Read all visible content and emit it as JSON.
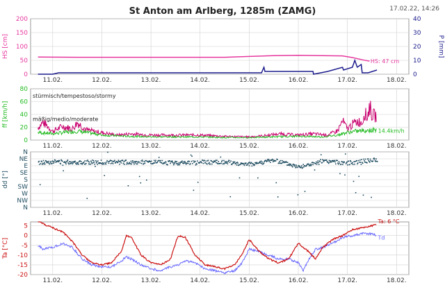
{
  "header": {
    "title": "St Anton am Arlberg, 1285m (ZAMG)",
    "timestamp": "17.02.22, 14:26"
  },
  "colors": {
    "hs": "#e6379e",
    "precip": "#1a1a8c",
    "ff": "#c8006e",
    "fx": "#22bb22",
    "dd": "#1c4a5e",
    "ta": "#cc1111",
    "td": "#6666ff",
    "frame": "#999999",
    "grid": "#d0d0d0",
    "text": "#333333"
  },
  "chart_data": [
    {
      "type": "line",
      "panel": "snow",
      "ylabel": "HS [cm]",
      "ylabel_right": "P [mm]",
      "ylim": [
        0,
        200
      ],
      "ylim_right": [
        0,
        40
      ],
      "yticks": [
        "0",
        "50",
        "100",
        "150",
        "200"
      ],
      "yticks_right": [
        "0",
        "10",
        "20",
        "30",
        "40"
      ],
      "x_categories": [
        "11.02.",
        "12.02.",
        "13.02.",
        "14.02.",
        "15.02.",
        "16.02.",
        "17.02.",
        "18.02."
      ],
      "annotation": "HS: 47 cm",
      "series": [
        {
          "name": "HS",
          "x": [
            10.7,
            11.5,
            12.5,
            13.5,
            14.5,
            15.0,
            15.5,
            16.0,
            16.5,
            16.9,
            17.1,
            17.3,
            17.45
          ],
          "y": [
            62,
            61,
            61,
            61,
            61,
            64,
            67,
            68,
            67,
            66,
            60,
            52,
            47
          ]
        },
        {
          "name": "P",
          "x": [
            10.7,
            11.0,
            11.12,
            12.0,
            13.0,
            14.0,
            15.0,
            15.25,
            15.3,
            15.32,
            15.5,
            15.8,
            16.0,
            16.3,
            16.31,
            16.6,
            16.9,
            16.92,
            17.1,
            17.15,
            17.2,
            17.28,
            17.3,
            17.42,
            17.6
          ],
          "y": [
            0,
            0,
            1,
            1,
            1,
            1,
            1,
            1,
            5,
            2,
            2,
            2,
            2,
            2,
            0,
            2,
            5,
            3,
            5,
            10,
            5,
            7,
            1,
            1,
            3
          ]
        }
      ]
    },
    {
      "type": "line",
      "panel": "wind",
      "ylabel": "ff [km/h]",
      "ylim": [
        0,
        80
      ],
      "yticks": [
        "0",
        "20",
        "40",
        "60",
        "80"
      ],
      "x_categories": [
        "11.02.",
        "12.02.",
        "13.02.",
        "14.02.",
        "15.02.",
        "16.02.",
        "17.02.",
        "18.02."
      ],
      "bands": [
        "stürmisch/tempestoso/stormy",
        "mäßig/medio/moderate"
      ],
      "annotation": "ff: 14.4km/h",
      "series": [
        {
          "name": "ff_max",
          "x": [
            10.7,
            10.8,
            10.9,
            11.0,
            11.2,
            11.4,
            11.5,
            11.7,
            12.0,
            12.3,
            12.6,
            13.0,
            13.5,
            14.0,
            14.5,
            15.0,
            15.3,
            15.6,
            16.0,
            16.3,
            16.6,
            16.8,
            16.9,
            17.0,
            17.1,
            17.2,
            17.3,
            17.35,
            17.4,
            17.45,
            17.5,
            17.6
          ],
          "y": [
            20,
            28,
            22,
            14,
            22,
            18,
            28,
            16,
            12,
            8,
            10,
            8,
            8,
            8,
            6,
            5,
            7,
            10,
            8,
            10,
            8,
            15,
            30,
            18,
            25,
            30,
            28,
            45,
            35,
            55,
            40,
            38
          ]
        },
        {
          "name": "ff_mean",
          "x": [
            10.7,
            11.0,
            11.5,
            12.0,
            12.5,
            13.0,
            13.5,
            14.0,
            14.5,
            15.0,
            15.5,
            16.0,
            16.5,
            16.8,
            17.0,
            17.2,
            17.4,
            17.6
          ],
          "y": [
            12,
            10,
            14,
            8,
            6,
            5,
            5,
            5,
            4,
            4,
            5,
            6,
            5,
            8,
            12,
            14,
            15,
            16
          ]
        }
      ]
    },
    {
      "type": "scatter",
      "panel": "direction",
      "ylabel": "dd [°]",
      "ylim": [
        0,
        8
      ],
      "yticks": [
        "N",
        "NW",
        "W",
        "SW",
        "S",
        "SE",
        "E",
        "NE",
        "N"
      ],
      "x_categories": [
        "11.02.",
        "12.02.",
        "13.02.",
        "14.02.",
        "15.02.",
        "16.02.",
        "17.02.",
        "18.02."
      ],
      "series": [
        {
          "name": "dd",
          "x": [
            10.7,
            11.0,
            11.5,
            12.0,
            12.5,
            13.0,
            13.5,
            14.0,
            14.5,
            15.0,
            15.5,
            16.0,
            16.5,
            17.0,
            17.5
          ],
          "y": [
            6.4,
            6.6,
            6.5,
            6.5,
            6.5,
            6.5,
            6.4,
            6.5,
            6.5,
            6.2,
            6.8,
            5.8,
            6.6,
            6.4,
            6.8
          ]
        }
      ]
    },
    {
      "type": "line",
      "panel": "temperature",
      "ylabel": "Ta [°C]",
      "ylim": [
        -20,
        7
      ],
      "yticks": [
        "-20",
        "-15",
        "-10",
        "-5",
        "0",
        "5"
      ],
      "x_categories": [
        "11.02.",
        "12.02.",
        "13.02.",
        "14.02.",
        "15.02.",
        "16.02.",
        "17.02.",
        "18.02."
      ],
      "annotations": [
        "Ta: 6 °C",
        "Td"
      ],
      "series": [
        {
          "name": "Ta",
          "x": [
            10.7,
            10.8,
            11.0,
            11.2,
            11.4,
            11.6,
            11.8,
            12.0,
            12.2,
            12.4,
            12.5,
            12.6,
            12.8,
            13.0,
            13.2,
            13.4,
            13.55,
            13.7,
            13.9,
            14.1,
            14.3,
            14.5,
            14.7,
            14.85,
            15.0,
            15.2,
            15.4,
            15.6,
            15.8,
            16.0,
            16.1,
            16.2,
            16.35,
            16.5,
            16.7,
            16.9,
            17.1,
            17.3,
            17.5,
            17.6
          ],
          "y": [
            8,
            6,
            4,
            2,
            -3,
            -10,
            -14,
            -15,
            -14,
            -8,
            0,
            -1,
            -10,
            -14,
            -15,
            -12,
            0,
            -1,
            -10,
            -15,
            -16,
            -17,
            -15,
            -10,
            -2,
            -8,
            -12,
            -14,
            -12,
            -4,
            -6,
            -8,
            -12,
            -6,
            -2,
            0,
            3,
            4,
            5,
            6
          ]
        },
        {
          "name": "Td",
          "x": [
            10.7,
            10.8,
            11.0,
            11.2,
            11.4,
            11.6,
            11.8,
            12.0,
            12.2,
            12.4,
            12.5,
            12.6,
            12.8,
            13.0,
            13.2,
            13.4,
            13.55,
            13.7,
            13.9,
            14.1,
            14.3,
            14.5,
            14.7,
            14.85,
            15.0,
            15.2,
            15.4,
            15.6,
            15.8,
            16.0,
            16.1,
            16.2,
            16.35,
            16.5,
            16.7,
            16.9,
            17.1,
            17.3,
            17.5,
            17.6
          ],
          "y": [
            -5,
            -7,
            -6,
            -4,
            -6,
            -12,
            -15,
            -16,
            -16,
            -13,
            -11,
            -12,
            -15,
            -17,
            -18,
            -16,
            -15,
            -13,
            -14,
            -17,
            -18,
            -19,
            -18,
            -14,
            -7,
            -8,
            -10,
            -12,
            -12,
            -14,
            -18,
            -13,
            -7,
            -6,
            -4,
            -1,
            0,
            1,
            1,
            0
          ]
        }
      ]
    }
  ]
}
